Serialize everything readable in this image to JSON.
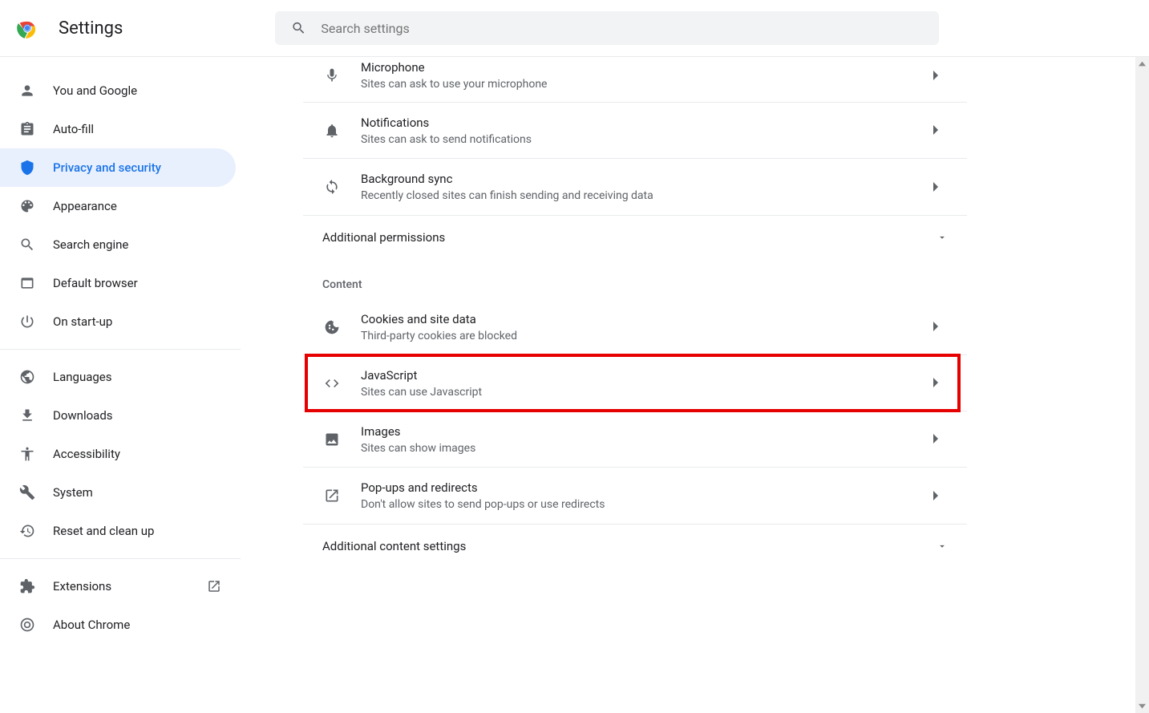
{
  "header": {
    "title": "Settings",
    "search_placeholder": "Search settings"
  },
  "sidebar": {
    "group1": [
      {
        "id": "you-and-google",
        "label": "You and Google"
      },
      {
        "id": "auto-fill",
        "label": "Auto-fill"
      },
      {
        "id": "privacy-and-security",
        "label": "Privacy and security",
        "active": true
      },
      {
        "id": "appearance",
        "label": "Appearance"
      },
      {
        "id": "search-engine",
        "label": "Search engine"
      },
      {
        "id": "default-browser",
        "label": "Default browser"
      },
      {
        "id": "on-start-up",
        "label": "On start-up"
      }
    ],
    "group2": [
      {
        "id": "languages",
        "label": "Languages"
      },
      {
        "id": "downloads",
        "label": "Downloads"
      },
      {
        "id": "accessibility",
        "label": "Accessibility"
      },
      {
        "id": "system",
        "label": "System"
      },
      {
        "id": "reset",
        "label": "Reset and clean up"
      }
    ],
    "group3": [
      {
        "id": "extensions",
        "label": "Extensions"
      },
      {
        "id": "about-chrome",
        "label": "About Chrome"
      }
    ]
  },
  "content": {
    "permission_rows": [
      {
        "id": "microphone",
        "title": "Microphone",
        "sub": "Sites can ask to use your microphone"
      },
      {
        "id": "notifications",
        "title": "Notifications",
        "sub": "Sites can ask to send notifications"
      },
      {
        "id": "background-sync",
        "title": "Background sync",
        "sub": "Recently closed sites can finish sending and receiving data"
      }
    ],
    "additional_permissions": "Additional permissions",
    "section_content": "Content",
    "content_rows": [
      {
        "id": "cookies",
        "title": "Cookies and site data",
        "sub": "Third-party cookies are blocked"
      },
      {
        "id": "javascript",
        "title": "JavaScript",
        "sub": "Sites can use Javascript",
        "highlighted": true
      },
      {
        "id": "images",
        "title": "Images",
        "sub": "Sites can show images"
      },
      {
        "id": "popups",
        "title": "Pop-ups and redirects",
        "sub": "Don't allow sites to send pop-ups or use redirects"
      }
    ],
    "additional_content": "Additional content settings"
  }
}
